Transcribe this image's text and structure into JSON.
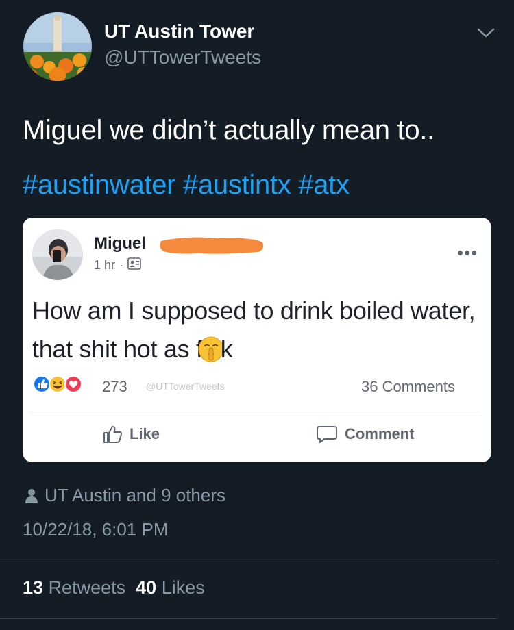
{
  "author": {
    "display_name": "UT Austin Tower",
    "handle": "@UTTowerTweets"
  },
  "tweet": {
    "text": "Miguel we didn’t actually mean to..",
    "hashtags": [
      "#austinwater",
      "#austintx",
      "#atx"
    ]
  },
  "embedded_post": {
    "author_name": "Miguel",
    "time": "1 hr",
    "separator": "·",
    "text_before_emoji": "How am I supposed to drink boiled water, that shit hot as f",
    "text_after_emoji": "k",
    "reaction_count": "273",
    "watermark": "@UTTowerTweets",
    "comments_count": "36 Comments",
    "like_label": "Like",
    "comment_label": "Comment",
    "reaction_icons": [
      "like-reaction-icon",
      "haha-reaction-icon",
      "love-reaction-icon"
    ],
    "emoji_icon": "shushing-face-emoji"
  },
  "liked_by": "UT Austin and 9 others",
  "timestamp": "10/22/18, 6:01 PM",
  "stats": {
    "retweets_count": "13",
    "retweets_label": "Retweets",
    "likes_count": "40",
    "likes_label": "Likes"
  },
  "colors": {
    "background": "#141d26",
    "hashtag": "#1da1f2",
    "secondary_text": "#8899a6",
    "redaction": "#f58a3c"
  }
}
